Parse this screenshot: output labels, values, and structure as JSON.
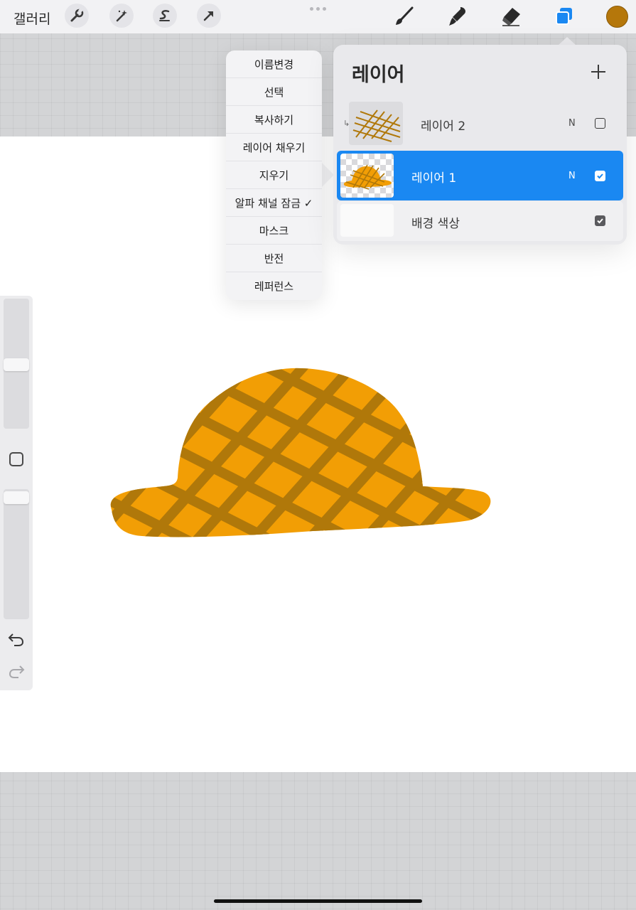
{
  "topbar": {
    "gallery_label": "갤러리",
    "tools_left": [
      "wrench-icon",
      "magic-wand-icon",
      "selection-icon",
      "transform-arrow-icon"
    ],
    "tools_right": [
      "brush-icon",
      "smudge-icon",
      "eraser-icon",
      "layers-icon"
    ],
    "current_color": "#b5770b",
    "active_tool_color": "#1a88f2"
  },
  "context_menu": {
    "items": [
      "이름변경",
      "선택",
      "복사하기",
      "레이어 채우기",
      "지우기",
      "알파 채널 잠금 ✓",
      "마스크",
      "반전",
      "레퍼런스"
    ]
  },
  "layers_panel": {
    "title": "레이어",
    "layers": [
      {
        "name": "레이어 2",
        "mode": "N",
        "visible": false,
        "clipped": true
      },
      {
        "name": "레이어 1",
        "mode": "N",
        "visible": true,
        "selected": true
      },
      {
        "name": "배경 색상",
        "visible": true
      }
    ]
  },
  "canvas": {
    "hat_fill": "#f29e05",
    "hat_pattern": "#b0780a",
    "background": "#ffffff"
  },
  "sidebar": {
    "icons": [
      "brush-size-slider",
      "modify-square-icon",
      "opacity-slider",
      "undo-icon",
      "redo-icon"
    ]
  }
}
